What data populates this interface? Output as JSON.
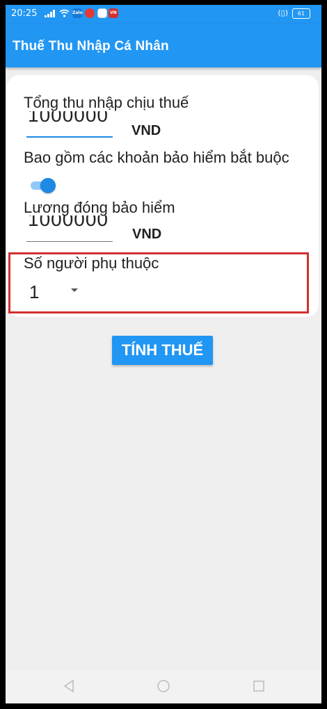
{
  "status_bar": {
    "time": "20:25",
    "notification_icons": [
      "Zalo",
      "",
      "",
      "VN"
    ],
    "battery": "61"
  },
  "app_bar": {
    "title": "Thuế Thu Nhập Cá Nhân"
  },
  "form": {
    "total_income": {
      "label": "Tổng thu nhập chịu thuế",
      "value": "1000000",
      "unit": "VND"
    },
    "include_insurance": {
      "label": "Bao gồm các khoản bảo hiểm bắt buộc",
      "checked": true
    },
    "insurance_salary": {
      "label": "Lương đóng bảo hiểm",
      "value": "1000000",
      "unit": "VND"
    },
    "dependents": {
      "label": "Số người phụ thuộc",
      "value": "1"
    }
  },
  "calculate_button": {
    "label": "TÍNH THUẾ"
  },
  "colors": {
    "primary": "#2196f3",
    "highlight": "#d32f2f",
    "background": "#efefef"
  }
}
